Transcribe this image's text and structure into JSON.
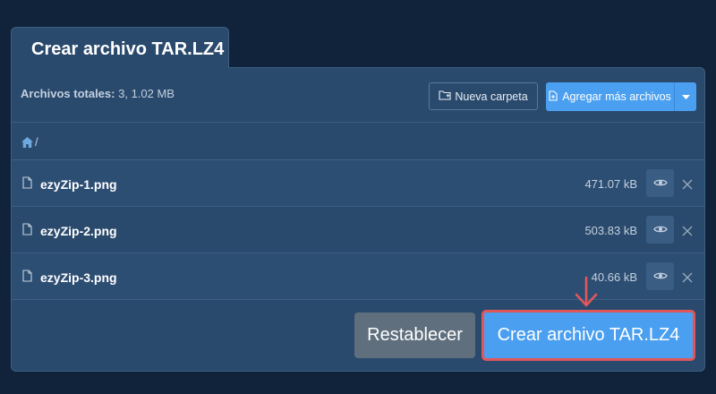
{
  "tab": {
    "title": "Crear archivo TAR.LZ4"
  },
  "toolbar": {
    "totals_label": "Archivos totales:",
    "totals_value": "3, 1.02 MB",
    "new_folder_label": "Nueva carpeta",
    "add_files_label": "Agregar más archivos"
  },
  "breadcrumb": {
    "separator": "/"
  },
  "files": [
    {
      "name": "ezyZip-1.png",
      "size": "471.07 kB"
    },
    {
      "name": "ezyZip-2.png",
      "size": "503.83 kB"
    },
    {
      "name": "ezyZip-3.png",
      "size": "40.66 kB"
    }
  ],
  "actions": {
    "reset_label": "Restablecer",
    "create_label": "Crear archivo TAR.LZ4"
  },
  "icons": {
    "home": "home-icon",
    "file": "file-icon",
    "eye": "eye-icon",
    "close": "close-icon",
    "folder": "folder-plus-icon",
    "add_file": "file-plus-icon",
    "caret": "caret-down-icon",
    "arrow": "arrow-down-icon"
  },
  "colors": {
    "background": "#10233a",
    "panel": "#2a4a6d",
    "accent": "#4a9ff0",
    "reset": "#5f6f7d",
    "highlight": "#e0575a"
  }
}
